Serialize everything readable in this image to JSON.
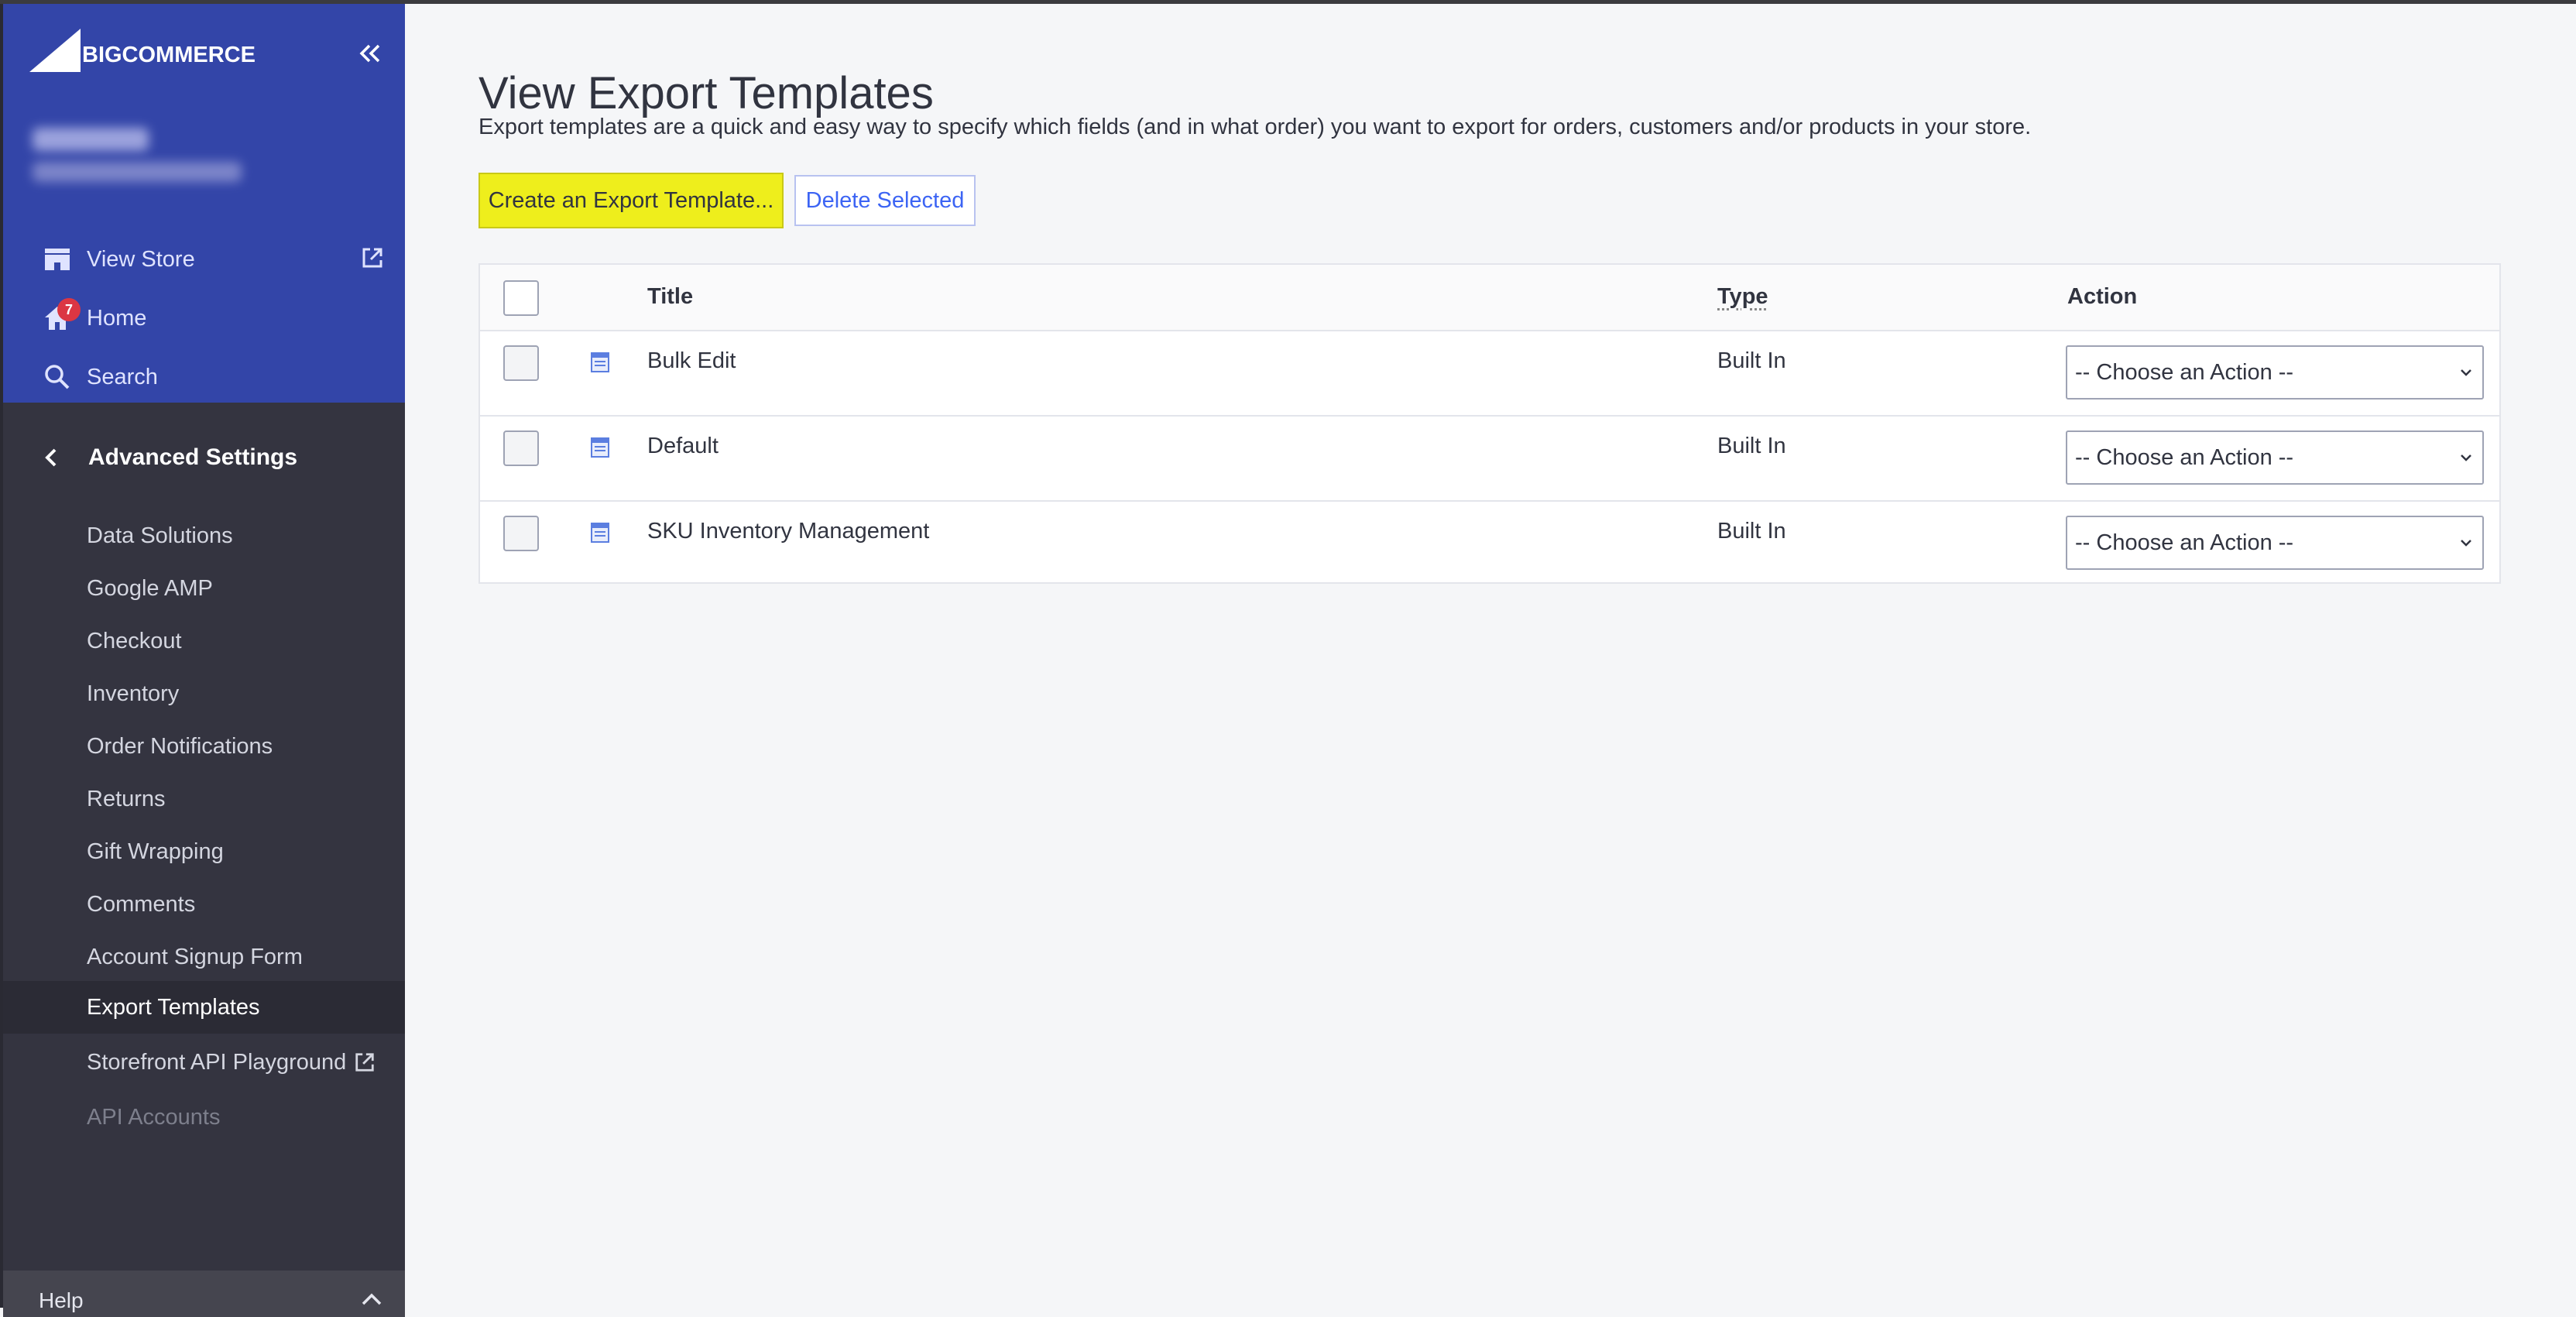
{
  "brand": {
    "logo_text": "BIGCOMMERCE",
    "accent": "#3345a8"
  },
  "sidebar": {
    "nav": [
      {
        "label": "View Store",
        "icon": "store-icon"
      },
      {
        "label": "Home",
        "icon": "home-icon",
        "badge": "7"
      },
      {
        "label": "Search",
        "icon": "search-icon"
      }
    ],
    "section_title": "Advanced Settings",
    "sub_items": [
      {
        "label": "Data Solutions"
      },
      {
        "label": "Google AMP"
      },
      {
        "label": "Checkout"
      },
      {
        "label": "Inventory"
      },
      {
        "label": "Order Notifications"
      },
      {
        "label": "Returns"
      },
      {
        "label": "Gift Wrapping"
      },
      {
        "label": "Comments"
      },
      {
        "label": "Account Signup Form"
      },
      {
        "label": "Export Templates",
        "active": true
      },
      {
        "label": "Storefront API Playground",
        "external": true
      },
      {
        "label": "API Accounts",
        "disabled": true
      }
    ],
    "help_label": "Help"
  },
  "main": {
    "title": "View Export Templates",
    "description": "Export templates are a quick and easy way to specify which fields (and in what order) you want to export for orders, customers and/or products in your store.",
    "create_button": "Create an Export Template...",
    "delete_button": "Delete Selected",
    "table": {
      "headers": {
        "title": "Title",
        "type": "Type",
        "action": "Action"
      },
      "rows": [
        {
          "title": "Bulk Edit",
          "type": "Built In",
          "action": "-- Choose an Action --"
        },
        {
          "title": "Default",
          "type": "Built In",
          "action": "-- Choose an Action --"
        },
        {
          "title": "SKU Inventory Management",
          "type": "Built In",
          "action": "-- Choose an Action --"
        }
      ]
    }
  }
}
